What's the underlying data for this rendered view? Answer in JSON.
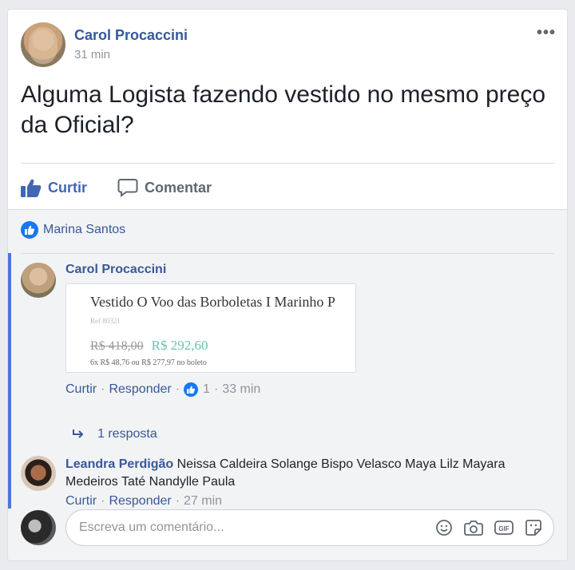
{
  "post": {
    "author": "Carol Procaccini",
    "time": "31 min",
    "text": "Alguma Logista fazendo vestido no mesmo preço da Oficial?",
    "more_icon": "more-horizontal-icon"
  },
  "actions": {
    "like_label": "Curtir",
    "comment_label": "Comentar"
  },
  "likers": {
    "name": "Marina Santos"
  },
  "comments": [
    {
      "author": "Carol Procaccini",
      "attachment": {
        "title": "Vestido O Voo das Borboletas I Marinho P",
        "ref": "Ref 80321",
        "old_price": "R$ 418,00",
        "new_price": "R$ 292,60",
        "installments": "6x R$ 48,76 ou R$ 277,97 no boleto"
      },
      "like_label": "Curtir",
      "reply_label": "Responder",
      "reactions": "1",
      "time": "33 min",
      "replies_label": "1 resposta"
    },
    {
      "author": "Leandra Perdigão",
      "text": "Neissa Caldeira Solange Bispo Velasco Maya Lilz Mayara Medeiros Taté Nandylle Paula",
      "like_label": "Curtir",
      "reply_label": "Responder",
      "time": "27 min"
    }
  ],
  "composer": {
    "placeholder": "Escreva um comentário...",
    "icons": [
      "emoji-icon",
      "camera-icon",
      "gif-icon",
      "sticker-icon"
    ]
  },
  "colors": {
    "link": "#385898",
    "like_blue": "#4267b2",
    "thread_line": "#4a76d6",
    "price_green": "#6fc0b0"
  }
}
